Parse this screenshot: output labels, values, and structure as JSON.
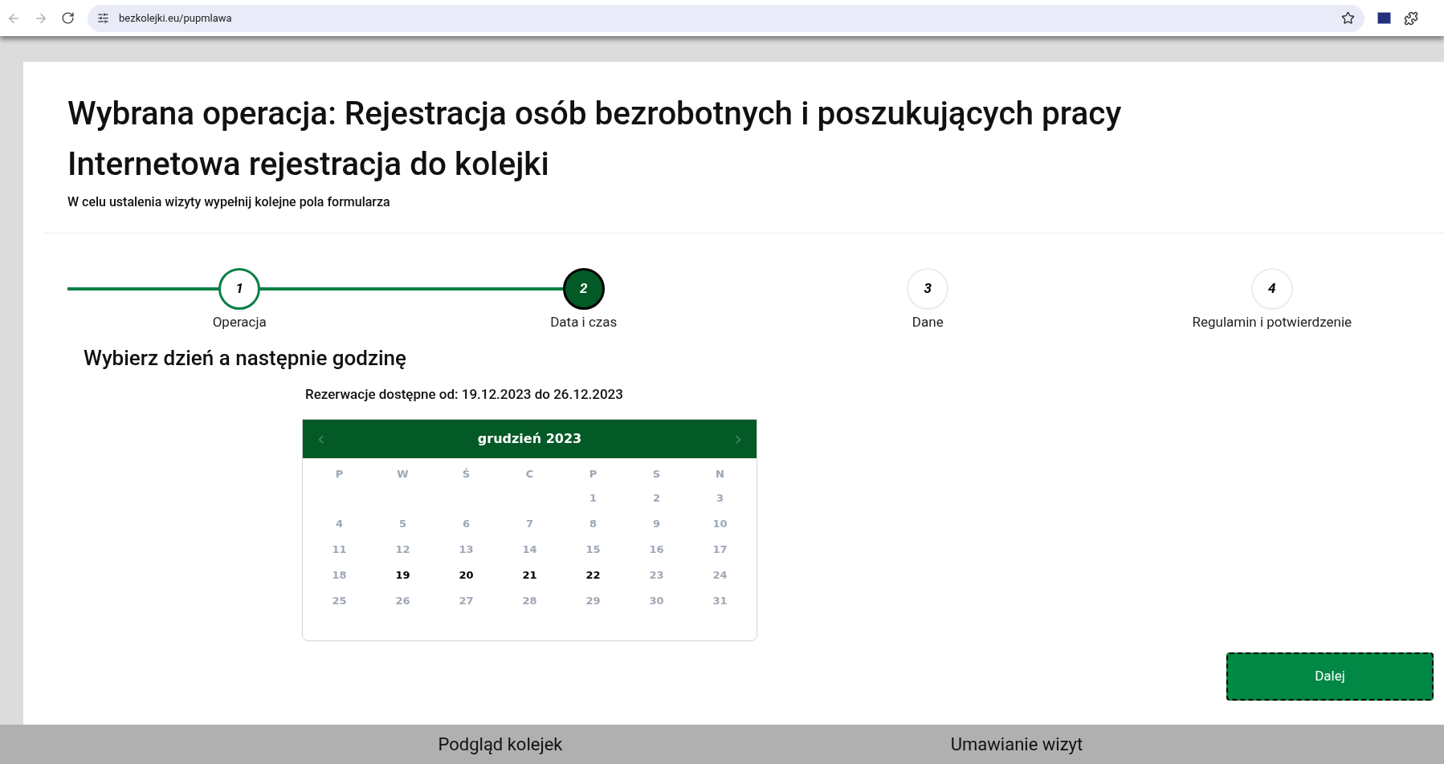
{
  "browser": {
    "url": "bezkolejki.eu/pupmlawa"
  },
  "header": {
    "title": "Wybrana operacja: Rejestracja osób bezrobotnych i poszukujących pracy",
    "subtitle": "Internetowa rejestracja do kolejki",
    "hint": "W celu ustalenia wizyty wypełnij kolejne pola formularza"
  },
  "steps": [
    {
      "number": "1",
      "label": "Operacja",
      "completed": true,
      "selected": false
    },
    {
      "number": "2",
      "label": "Data i czas",
      "completed": false,
      "selected": true
    },
    {
      "number": "3",
      "label": "Dane",
      "completed": false,
      "selected": false
    },
    {
      "number": "4",
      "label": "Regulamin i potwierdzenie",
      "completed": false,
      "selected": false
    }
  ],
  "section_title": "Wybierz dzień a następnie godzinę",
  "availability": "Rezerwacje dostępne od: 19.12.2023 do 26.12.2023",
  "calendar": {
    "prev": "‹",
    "month": "grudzień 2023",
    "next": "›",
    "weekdays": [
      "P",
      "W",
      "Ś",
      "C",
      "P",
      "S",
      "N"
    ],
    "weeks": [
      {
        "days": [
          {
            "label": "1",
            "available": false
          },
          {
            "label": "2",
            "available": false
          },
          {
            "label": "3",
            "available": false
          }
        ]
      },
      {
        "days": [
          {
            "label": "4",
            "available": false
          },
          {
            "label": "5",
            "available": false
          },
          {
            "label": "6",
            "available": false
          },
          {
            "label": "7",
            "available": false
          },
          {
            "label": "8",
            "available": false
          },
          {
            "label": "9",
            "available": false
          },
          {
            "label": "10",
            "available": false
          }
        ]
      },
      {
        "days": [
          {
            "label": "11",
            "available": false
          },
          {
            "label": "12",
            "available": false
          },
          {
            "label": "13",
            "available": false
          },
          {
            "label": "14",
            "available": false
          },
          {
            "label": "15",
            "available": false
          },
          {
            "label": "16",
            "available": false
          },
          {
            "label": "17",
            "available": false
          }
        ]
      },
      {
        "days": [
          {
            "label": "18",
            "available": false
          },
          {
            "label": "19",
            "available": true
          },
          {
            "label": "20",
            "available": true
          },
          {
            "label": "21",
            "available": true
          },
          {
            "label": "22",
            "available": true
          },
          {
            "label": "23",
            "available": false
          },
          {
            "label": "24",
            "available": false
          }
        ]
      },
      {
        "days": [
          {
            "label": "25",
            "available": false
          },
          {
            "label": "26",
            "available": false
          },
          {
            "label": "27",
            "available": false
          },
          {
            "label": "28",
            "available": false
          },
          {
            "label": "29",
            "available": false
          },
          {
            "label": "30",
            "available": false
          },
          {
            "label": "31",
            "available": false
          }
        ]
      }
    ]
  },
  "next_button": "Dalej",
  "footer": {
    "links": [
      "Podgląd kolejek",
      "Umawianie wizyt"
    ]
  }
}
